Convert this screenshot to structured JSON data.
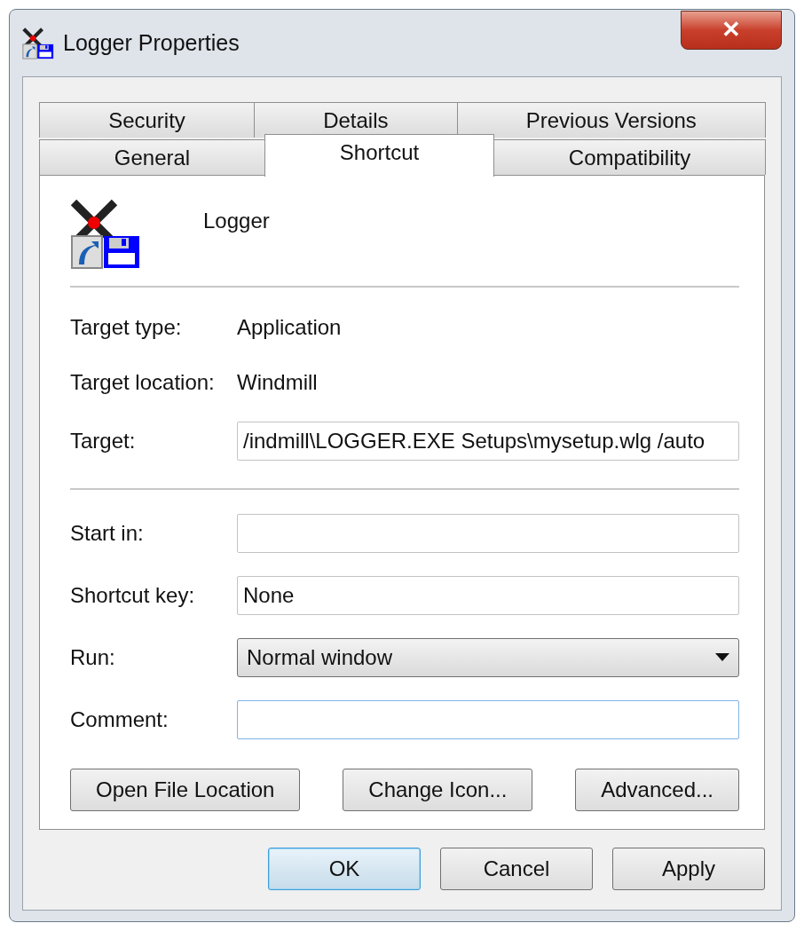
{
  "window": {
    "title": "Logger Properties",
    "close": "✕"
  },
  "tab_rows": [
    [
      {
        "label": "Security",
        "selected": false
      },
      {
        "label": "Details",
        "selected": false
      },
      {
        "label": "Previous Versions",
        "selected": false
      }
    ],
    [
      {
        "label": "General",
        "selected": false
      },
      {
        "label": "Shortcut",
        "selected": true
      },
      {
        "label": "Compatibility",
        "selected": false
      }
    ]
  ],
  "shortcut_name": "Logger",
  "groups": [
    [
      {
        "kind": "text",
        "label": "Target type:",
        "value": "Application"
      },
      {
        "kind": "text",
        "label": "Target location:",
        "value": "Windmill"
      },
      {
        "kind": "field",
        "label": "Target:",
        "value": "/indmill\\LOGGER.EXE Setups\\mysetup.wlg /auto",
        "focused": false
      }
    ],
    [
      {
        "kind": "field",
        "label": "Start in:",
        "focused": false
      },
      {
        "kind": "field",
        "label": "Shortcut key:",
        "value": "None",
        "focused": false
      },
      {
        "kind": "dropdown",
        "label": "Run:",
        "value": "Normal window"
      },
      {
        "kind": "field",
        "label": "Comment:",
        "focused": true
      }
    ]
  ],
  "actions": [
    "Open File Location",
    "Change Icon...",
    "Advanced..."
  ],
  "buttons": [
    {
      "label": "OK",
      "default": true
    },
    {
      "label": "Cancel",
      "default": false
    },
    {
      "label": "Apply",
      "default": false
    }
  ]
}
